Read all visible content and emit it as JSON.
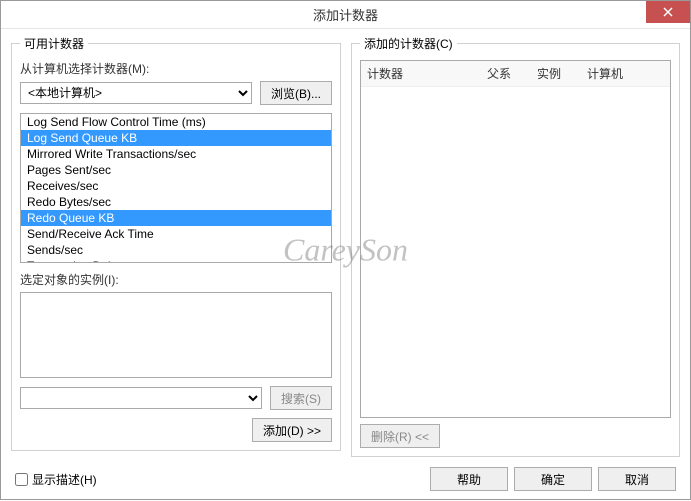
{
  "titlebar": {
    "title": "添加计数器"
  },
  "watermark": "CareySon",
  "left": {
    "group_label": "可用计数器",
    "computer_label": "从计算机选择计数器(M):",
    "computer_value": "<本地计算机>",
    "browse_btn": "浏览(B)...",
    "counters": [
      {
        "label": "Log Send Flow Control Time (ms)",
        "selected": false
      },
      {
        "label": "Log Send Queue KB",
        "selected": true
      },
      {
        "label": "Mirrored Write Transactions/sec",
        "selected": false
      },
      {
        "label": "Pages Sent/sec",
        "selected": false
      },
      {
        "label": "Receives/sec",
        "selected": false
      },
      {
        "label": "Redo Bytes/sec",
        "selected": false
      },
      {
        "label": "Redo Queue KB",
        "selected": true
      },
      {
        "label": "Send/Receive Ack Time",
        "selected": false
      },
      {
        "label": "Sends/sec",
        "selected": false
      },
      {
        "label": "Transaction Delay",
        "selected": false
      }
    ],
    "instance_label": "选定对象的实例(I):",
    "search_btn": "搜索(S)",
    "add_btn": "添加(D) >>"
  },
  "right": {
    "group_label": "添加的计数器(C)",
    "cols": {
      "counter": "计数器",
      "parent": "父系",
      "instance": "实例",
      "computer": "计算机"
    },
    "remove_btn": "删除(R) <<"
  },
  "bottom": {
    "show_desc": "显示描述(H)",
    "help": "帮助",
    "ok": "确定",
    "cancel": "取消"
  }
}
